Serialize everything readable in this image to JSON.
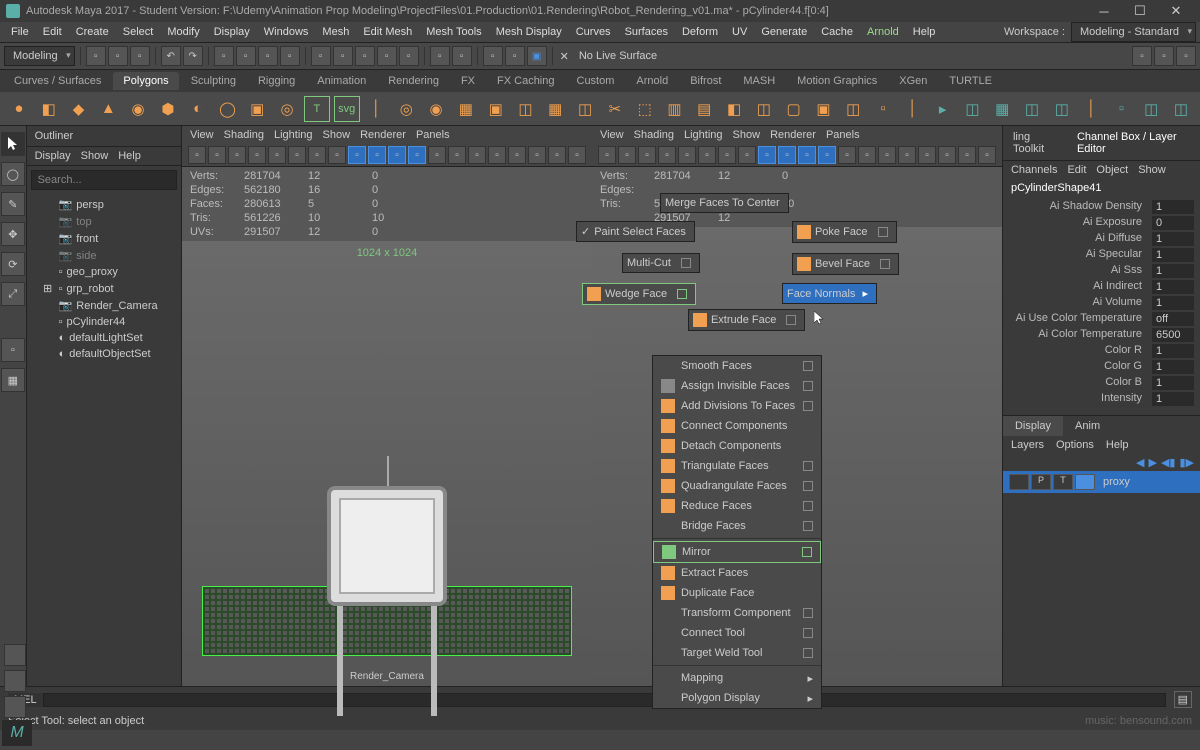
{
  "title": "Autodesk Maya 2017 - Student Version: F:\\Udemy\\Animation Prop Modeling\\ProjectFiles\\01.Production\\01.Rendering\\Robot_Rendering_v01.ma*  -  pCylinder44.f[0:4]",
  "menu": [
    "File",
    "Edit",
    "Create",
    "Select",
    "Modify",
    "Display",
    "Windows",
    "Mesh",
    "Edit Mesh",
    "Mesh Tools",
    "Mesh Display",
    "Curves",
    "Surfaces",
    "Deform",
    "UV",
    "Generate",
    "Cache",
    "Arnold",
    "Help"
  ],
  "mode_dd": "Modeling",
  "workspace_label": "Workspace :",
  "workspace_value": "Modeling - Standard",
  "no_live": "No Live Surface",
  "shelf_tabs": [
    "Curves / Surfaces",
    "Polygons",
    "Sculpting",
    "Rigging",
    "Animation",
    "Rendering",
    "FX",
    "FX Caching",
    "Custom",
    "Arnold",
    "Bifrost",
    "MASH",
    "Motion Graphics",
    "XGen",
    "TURTLE"
  ],
  "active_shelf": "Polygons",
  "outliner": {
    "title": "Outliner",
    "menu": [
      "Display",
      "Show",
      "Help"
    ],
    "search": "Search...",
    "nodes": [
      {
        "icon": "📷",
        "label": "persp"
      },
      {
        "icon": "📷",
        "label": "top",
        "dim": true
      },
      {
        "icon": "📷",
        "label": "front"
      },
      {
        "icon": "📷",
        "label": "side",
        "dim": true
      },
      {
        "icon": "▫",
        "label": "geo_proxy"
      },
      {
        "icon": "▫",
        "label": "grp_robot",
        "exp": true
      },
      {
        "icon": "📷",
        "label": "Render_Camera"
      },
      {
        "icon": "▫",
        "label": "pCylinder44"
      },
      {
        "icon": "◐",
        "label": "defaultLightSet"
      },
      {
        "icon": "◐",
        "label": "defaultObjectSet"
      }
    ]
  },
  "vp_menu": [
    "View",
    "Shading",
    "Lighting",
    "Show",
    "Renderer",
    "Panels"
  ],
  "stats1": {
    "dim": "1024 x 1024",
    "rows": [
      {
        "l": "Verts:",
        "a": "281704",
        "b": "12",
        "c": "0"
      },
      {
        "l": "Edges:",
        "a": "562180",
        "b": "16",
        "c": "0"
      },
      {
        "l": "Faces:",
        "a": "280613",
        "b": "5",
        "c": "0"
      },
      {
        "l": "Tris:",
        "a": "561226",
        "b": "10",
        "c": "10"
      },
      {
        "l": "UVs:",
        "a": "291507",
        "b": "12",
        "c": "0"
      }
    ],
    "camera": "Render_Camera"
  },
  "stats2_rows": [
    {
      "l": "Verts:",
      "a": "281704",
      "b": "12",
      "c": "0"
    },
    {
      "l": "Edges:",
      "a": "",
      "b": "",
      "c": ""
    },
    {
      "l": "Tris:",
      "a": "561226",
      "b": "",
      "c": "10"
    },
    {
      "l": "",
      "a": "291507",
      "b": "12",
      "c": ""
    }
  ],
  "marking": {
    "paint": "Paint Select Faces",
    "merge": "Merge Faces To Center",
    "poke": "Poke Face",
    "multicut": "Multi-Cut",
    "bevel": "Bevel Face",
    "wedge": "Wedge Face",
    "normals": "Face Normals",
    "extrude": "Extrude Face"
  },
  "ctx": [
    {
      "t": "Smooth Faces",
      "c": true
    },
    {
      "t": "Assign Invisible Faces",
      "c": true,
      "i": "#888"
    },
    {
      "t": "Add Divisions To Faces",
      "c": true,
      "i": "#f0a050"
    },
    {
      "t": "Connect Components",
      "i": "#f0a050"
    },
    {
      "t": "Detach Components",
      "i": "#f0a050"
    },
    {
      "t": "Triangulate Faces",
      "c": true,
      "i": "#f0a050"
    },
    {
      "t": "Quadrangulate Faces",
      "c": true,
      "i": "#f0a050"
    },
    {
      "t": "Reduce Faces",
      "c": true,
      "i": "#f0a050"
    },
    {
      "t": "Bridge Faces",
      "c": true
    },
    {
      "sep": true
    },
    {
      "t": "Mirror",
      "c": true,
      "green": true,
      "i": "#7ec97e"
    },
    {
      "t": "Extract Faces",
      "i": "#f0a050"
    },
    {
      "t": "Duplicate Face",
      "i": "#f0a050"
    },
    {
      "t": "Transform Component",
      "c": true
    },
    {
      "t": "Connect Tool",
      "c": true
    },
    {
      "t": "Target Weld Tool",
      "c": true
    },
    {
      "sep": true
    },
    {
      "t": "Mapping",
      "sub": true
    },
    {
      "t": "Polygon Display",
      "sub": true
    }
  ],
  "right": {
    "tabs": [
      "ling Toolkit",
      "Channel Box / Layer Editor"
    ],
    "menu": [
      "Channels",
      "Edit",
      "Object",
      "Show"
    ],
    "obj": "pCylinderShape41",
    "attrs": [
      {
        "l": "Ai Shadow Density",
        "v": "1"
      },
      {
        "l": "Ai Exposure",
        "v": "0"
      },
      {
        "l": "Ai Diffuse",
        "v": "1"
      },
      {
        "l": "Ai Specular",
        "v": "1"
      },
      {
        "l": "Ai Sss",
        "v": "1"
      },
      {
        "l": "Ai Indirect",
        "v": "1"
      },
      {
        "l": "Ai Volume",
        "v": "1"
      },
      {
        "l": "Ai Use Color Temperature",
        "v": "off"
      },
      {
        "l": "Ai Color Temperature",
        "v": "6500"
      },
      {
        "l": "Color R",
        "v": "1"
      },
      {
        "l": "Color G",
        "v": "1"
      },
      {
        "l": "Color B",
        "v": "1"
      },
      {
        "l": "Intensity",
        "v": "1"
      }
    ],
    "layer_tabs": [
      "Display",
      "Anim"
    ],
    "layer_menu": [
      "Layers",
      "Options",
      "Help"
    ],
    "layer_name": "proxy"
  },
  "status": "Select Tool: select an object",
  "mel": "MEL",
  "watermark": "music: bensound.com"
}
